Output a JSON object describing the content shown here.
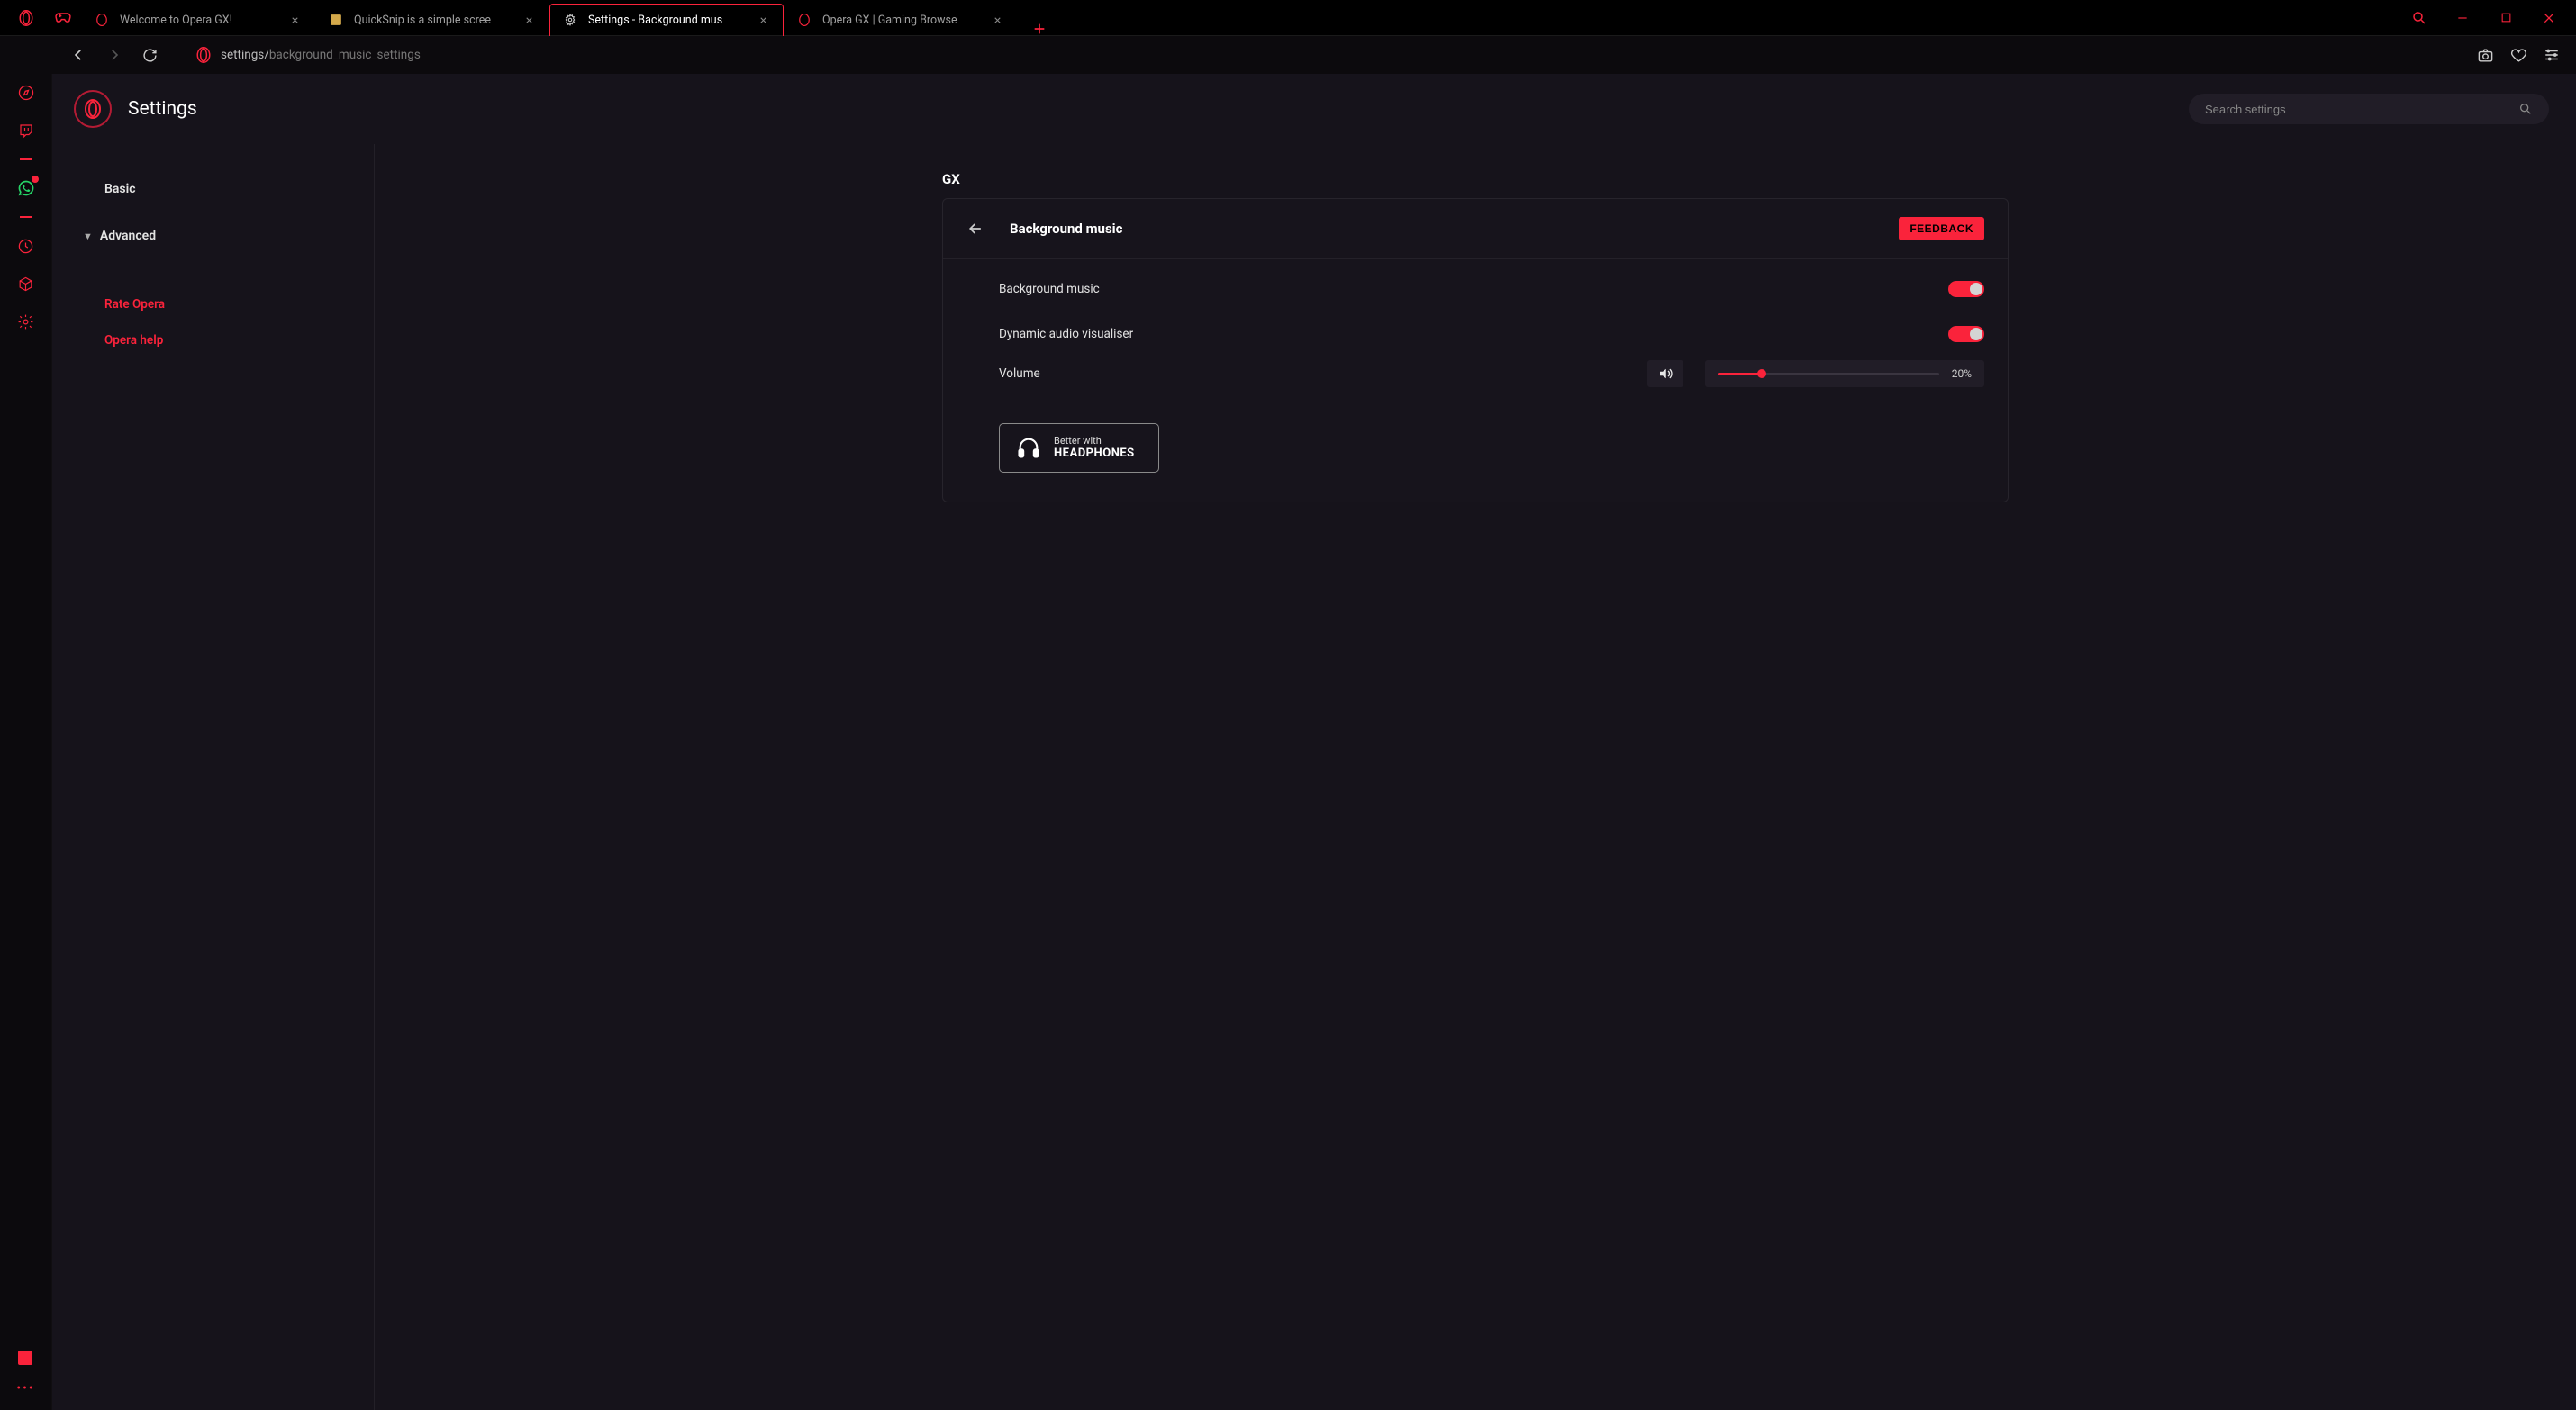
{
  "window": {
    "tabs": [
      {
        "title": "Welcome to Opera GX!",
        "favicon": "opera"
      },
      {
        "title": "QuickSnip is a simple scree",
        "favicon": "qs"
      },
      {
        "title": "Settings - Background mus",
        "favicon": "gear",
        "active": true
      },
      {
        "title": "Opera GX | Gaming Browse",
        "favicon": "opera"
      }
    ]
  },
  "urlbar": {
    "prefix": "settings/",
    "path": "background_music_settings"
  },
  "settings_header": {
    "title": "Settings",
    "search_placeholder": "Search settings"
  },
  "left_nav": {
    "items": [
      {
        "label": "Basic"
      },
      {
        "label": "Advanced",
        "expandable": true
      }
    ],
    "links": [
      {
        "label": "Rate Opera"
      },
      {
        "label": "Opera help"
      }
    ]
  },
  "page": {
    "section": "GX",
    "title": "Background music",
    "feedback": "FEEDBACK",
    "rows": [
      {
        "label": "Background music",
        "toggled": true
      },
      {
        "label": "Dynamic audio visualiser",
        "toggled": true
      }
    ],
    "volume": {
      "label": "Volume",
      "value_pct": 20,
      "value_text": "20%"
    },
    "headphones": {
      "line1": "Better with",
      "line2": "HEADPHONES"
    }
  },
  "siderail": {
    "items": [
      {
        "name": "compass-icon"
      },
      {
        "name": "twitch-icon"
      },
      {
        "name": "dash-icon",
        "type": "dash"
      },
      {
        "name": "whatsapp-icon",
        "type": "whatsapp"
      },
      {
        "name": "dash-icon-2",
        "type": "dash"
      },
      {
        "name": "clock-icon"
      },
      {
        "name": "cube-icon"
      },
      {
        "name": "gear-icon"
      }
    ]
  }
}
